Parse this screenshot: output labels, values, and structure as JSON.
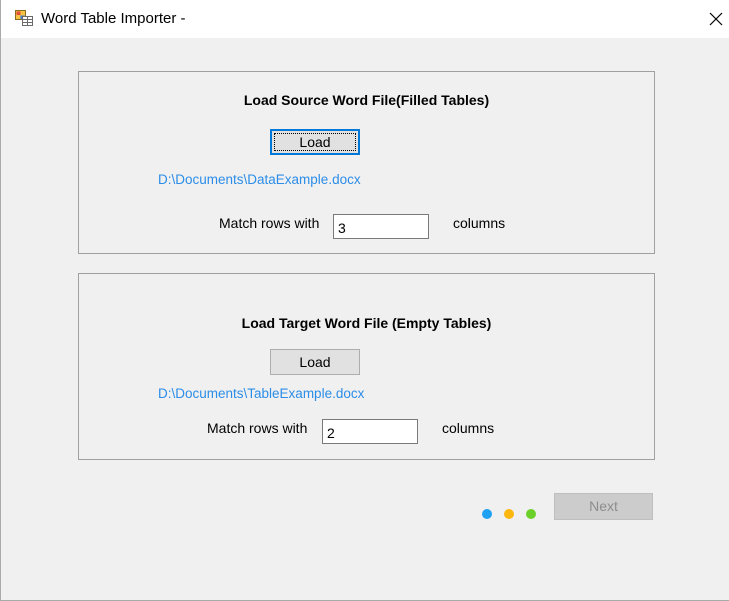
{
  "window": {
    "title": "Word Table Importer -",
    "close_icon": "close-icon",
    "app_icon": "word-table-importer-icon"
  },
  "source": {
    "heading": "Load Source Word File(Filled Tables)",
    "load_label": "Load",
    "file_path": "D:\\Documents\\DataExample.docx",
    "match_label": "Match rows with",
    "columns_value": "3",
    "columns_label": "columns"
  },
  "target": {
    "heading": "Load Target Word File (Empty Tables)",
    "load_label": "Load",
    "file_path": "D:\\Documents\\TableExample.docx",
    "match_label": "Match rows with",
    "columns_value": "2",
    "columns_label": "columns"
  },
  "wizard": {
    "step_dots": [
      {
        "name": "step-dot-1",
        "color": "#1ea1f2"
      },
      {
        "name": "step-dot-2",
        "color": "#fbb710"
      },
      {
        "name": "step-dot-3",
        "color": "#6bd12a"
      }
    ],
    "next_label": "Next",
    "next_enabled": false
  },
  "colors": {
    "path_link": "#2b8de8",
    "focus_border": "#0078d7",
    "window_bg": "#f0f0f0"
  }
}
